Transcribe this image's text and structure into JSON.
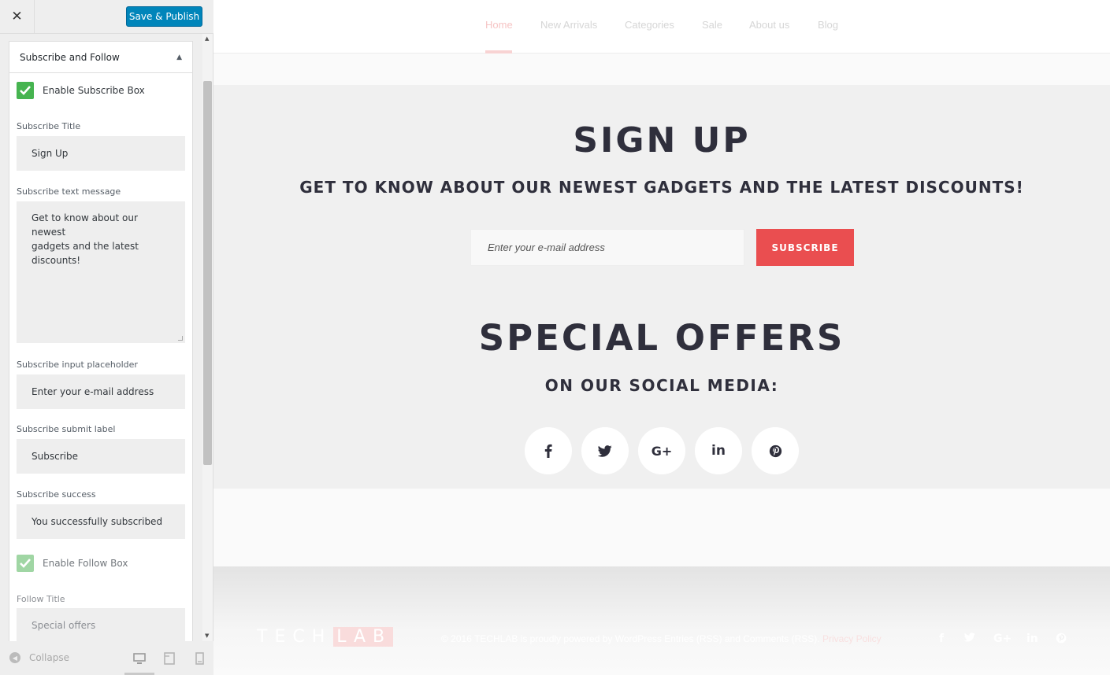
{
  "customizer": {
    "close_icon": "close-icon",
    "publish_label": "Save & Publish",
    "section_title": "Subscribe and Follow",
    "section_toggle_icon": "arrow-up-icon",
    "enable_subscribe_label": "Enable Subscribe Box",
    "enable_subscribe_checked": true,
    "subscribe_title_label": "Subscribe Title",
    "subscribe_title_value": "Sign Up",
    "subscribe_text_label": "Subscribe text message",
    "subscribe_text_value": "Get to know about our newest\ngadgets and the latest\ndiscounts!",
    "subscribe_placeholder_label": "Subscribe input placeholder",
    "subscribe_placeholder_value": "Enter your e-mail address",
    "subscribe_submit_label": "Subscribe submit label",
    "subscribe_submit_value": "Subscribe",
    "subscribe_success_label": "Subscribe success",
    "subscribe_success_value": "You successfully subscribed",
    "enable_follow_label": "Enable Follow Box",
    "enable_follow_checked": true,
    "follow_title_label": "Follow Title",
    "follow_title_value": "Special offers",
    "collapse_label": "Collapse",
    "devices": [
      "desktop-icon",
      "tablet-icon",
      "mobile-icon"
    ],
    "active_device": "desktop"
  },
  "site": {
    "nav": [
      {
        "label": "Home",
        "active": true
      },
      {
        "label": "New Arrivals"
      },
      {
        "label": "Categories"
      },
      {
        "label": "Sale"
      },
      {
        "label": "About us"
      },
      {
        "label": "Blog"
      }
    ],
    "signup_title": "SIGN UP",
    "signup_subtitle": "GET TO KNOW ABOUT OUR NEWEST GADGETS AND THE LATEST DISCOUNTS!",
    "email_placeholder": "Enter your e-mail address",
    "subscribe_button": "SUBSCRIBE",
    "offers_title": "SPECIAL OFFERS",
    "offers_subtitle": "ON OUR SOCIAL MEDIA:",
    "social": [
      "facebook-icon",
      "twitter-icon",
      "google-plus-icon",
      "linkedin-icon",
      "pinterest-icon"
    ],
    "footer": {
      "logo_main": "TECH",
      "logo_accent": "LAB",
      "copyright": "© 2016 TECHLAB is proudly powered by WordPress Entries (RSS) and Comments (RSS).",
      "privacy": "Privacy Policy"
    },
    "colors": {
      "accent": "#ea4e50",
      "publish_blue": "#0085ba",
      "checkbox_green": "#46b450",
      "heading_dark": "#2f2f3c"
    }
  }
}
